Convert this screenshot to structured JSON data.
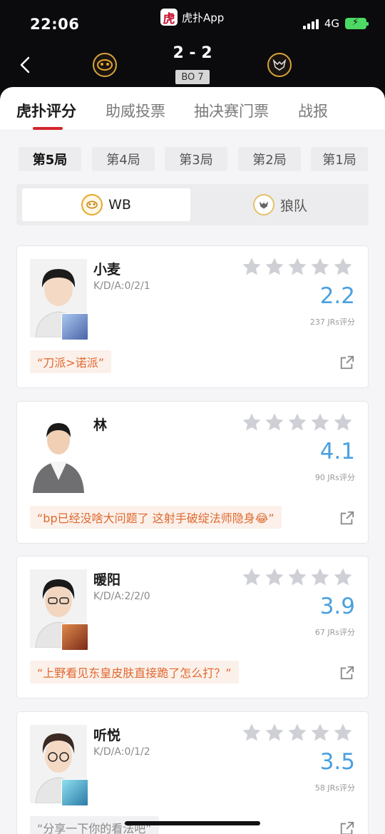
{
  "status": {
    "time": "22:06",
    "network": "4G",
    "app_name": "虎扑App",
    "app_logo_char": "虎"
  },
  "match": {
    "score": "2 - 2",
    "format": "BO 7"
  },
  "colors": {
    "rating_blue": "#4aa0e0",
    "tab_red": "#d4262a",
    "quote_orange": "#e06830"
  },
  "tabs": [
    {
      "label": "虎扑评分",
      "active": true
    },
    {
      "label": "助威投票",
      "active": false
    },
    {
      "label": "抽决赛门票",
      "active": false
    },
    {
      "label": "战报",
      "active": false
    }
  ],
  "games": [
    {
      "label": "第5局",
      "active": true
    },
    {
      "label": "第4局",
      "active": false
    },
    {
      "label": "第3局",
      "active": false
    },
    {
      "label": "第2局",
      "active": false
    },
    {
      "label": "第1局",
      "active": false
    }
  ],
  "teams": [
    {
      "name": "WB",
      "active": true,
      "logo_icon": "wb-logo-icon"
    },
    {
      "name": "狼队",
      "active": false,
      "logo_icon": "wolves-logo-icon"
    }
  ],
  "players": [
    {
      "name": "小麦",
      "kda": "K/D/A:0/2/1",
      "rating": "2.2",
      "jrs": "237 JRs评分",
      "comment": "“刀派>诺派”",
      "comment_style": "highlight",
      "has_hero": true,
      "hero_color": "#6a8fc8"
    },
    {
      "name": "林",
      "kda": "",
      "rating": "4.1",
      "jrs": "90 JRs评分",
      "comment": "“bp已经没啥大问题了 这射手破绽法师隐身😂”",
      "comment_style": "highlight",
      "has_hero": false,
      "hero_color": ""
    },
    {
      "name": "暖阳",
      "kda": "K/D/A:2/2/0",
      "rating": "3.9",
      "jrs": "67 JRs评分",
      "comment": "“上野看见东皇皮肤直接跪了怎么打？”",
      "comment_style": "highlight",
      "has_hero": true,
      "hero_color": "#b04a2a"
    },
    {
      "name": "听悦",
      "kda": "K/D/A:0/1/2",
      "rating": "3.5",
      "jrs": "58 JRs评分",
      "comment": "“分享一下你的看法吧”",
      "comment_style": "gray",
      "has_hero": true,
      "hero_color": "#3fb0c8"
    }
  ]
}
